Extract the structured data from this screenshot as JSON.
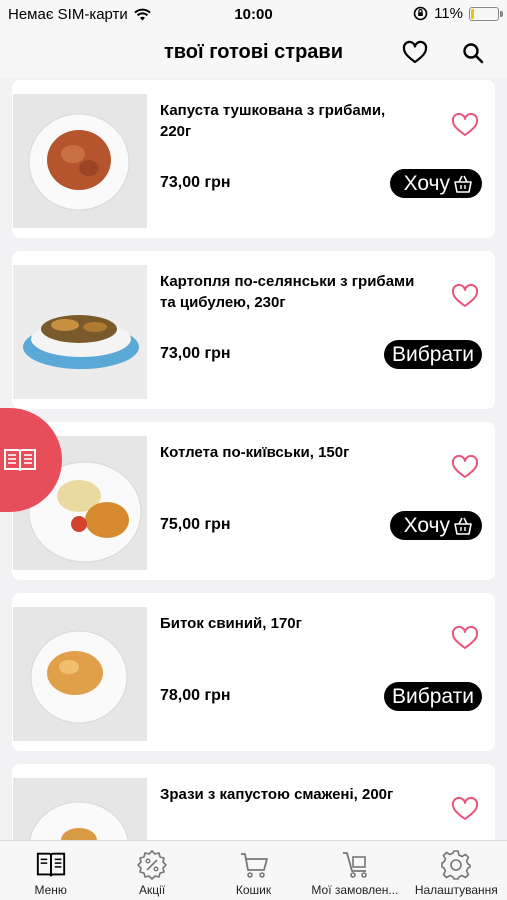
{
  "status_bar": {
    "carrier": "Немає SIM-карти",
    "time": "10:00",
    "battery_percent": "11%",
    "battery_level": 0.11
  },
  "header": {
    "title": "твої готові страви",
    "favorites_icon": "heart-icon",
    "search_icon": "search-icon"
  },
  "dishes": [
    {
      "name": "Капуста тушкована з грибами, 220г",
      "price": "73,00 грн",
      "button": "Хочу",
      "button_icon": "basket-icon",
      "favorite": false
    },
    {
      "name": "Картопля по-селянськи з грибами та цибулею, 230г",
      "price": "73,00 грн",
      "button": "Вибрати",
      "button_icon": "",
      "favorite": false
    },
    {
      "name": "Котлета по-київськи, 150г",
      "price": "75,00 грн",
      "button": "Хочу",
      "button_icon": "basket-icon",
      "favorite": false
    },
    {
      "name": "Биток свиний, 170г",
      "price": "78,00 грн",
      "button": "Вибрати",
      "button_icon": "",
      "favorite": false
    },
    {
      "name": "Зрази з капустою смажені, 200г",
      "price": "",
      "button": "",
      "button_icon": "",
      "favorite": false
    }
  ],
  "side_tab": {
    "icon": "menu-book-icon"
  },
  "tabbar": {
    "items": [
      {
        "label": "Меню",
        "icon": "menu-book-icon",
        "active": true
      },
      {
        "label": "Акції",
        "icon": "discount-icon",
        "active": false
      },
      {
        "label": "Кошик",
        "icon": "cart-icon",
        "active": false
      },
      {
        "label": "Мої замовлен...",
        "icon": "orders-icon",
        "active": false
      },
      {
        "label": "Налаштування",
        "icon": "gear-icon",
        "active": false
      }
    ]
  },
  "colors": {
    "accent": "#e74e5a",
    "favorite": "#e8567a",
    "button_bg": "#000000",
    "background": "#f2f2f4"
  }
}
